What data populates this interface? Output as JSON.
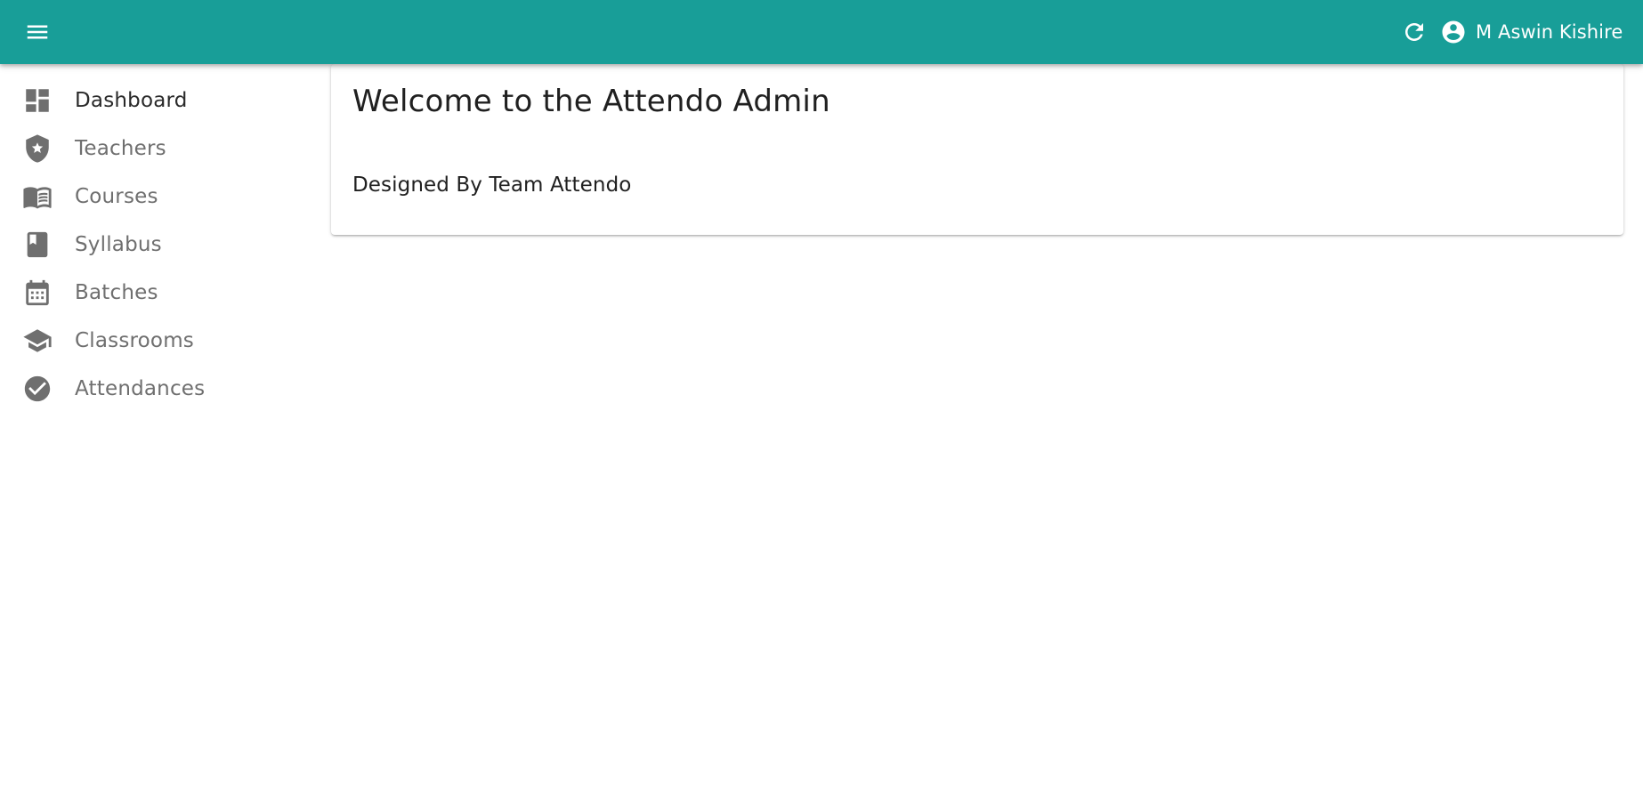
{
  "appbar": {
    "background_color": "#189e98",
    "menu_icon": "menu-icon",
    "refresh_icon": "refresh-icon",
    "user_icon": "account-circle-icon",
    "user_name": "M Aswin Kishire"
  },
  "sidebar": {
    "items": [
      {
        "label": "Dashboard",
        "icon": "dashboard-icon",
        "active": true
      },
      {
        "label": "Teachers",
        "icon": "shield-star-icon",
        "active": false
      },
      {
        "label": "Courses",
        "icon": "menu-book-icon",
        "active": false
      },
      {
        "label": "Syllabus",
        "icon": "book-icon",
        "active": false
      },
      {
        "label": "Batches",
        "icon": "calendar-icon",
        "active": false
      },
      {
        "label": "Classrooms",
        "icon": "school-icon",
        "active": false
      },
      {
        "label": "Attendances",
        "icon": "check-circle-icon",
        "active": false
      }
    ]
  },
  "main": {
    "card": {
      "title": "Welcome to the Attendo Admin",
      "body": "Designed By Team Attendo"
    }
  }
}
